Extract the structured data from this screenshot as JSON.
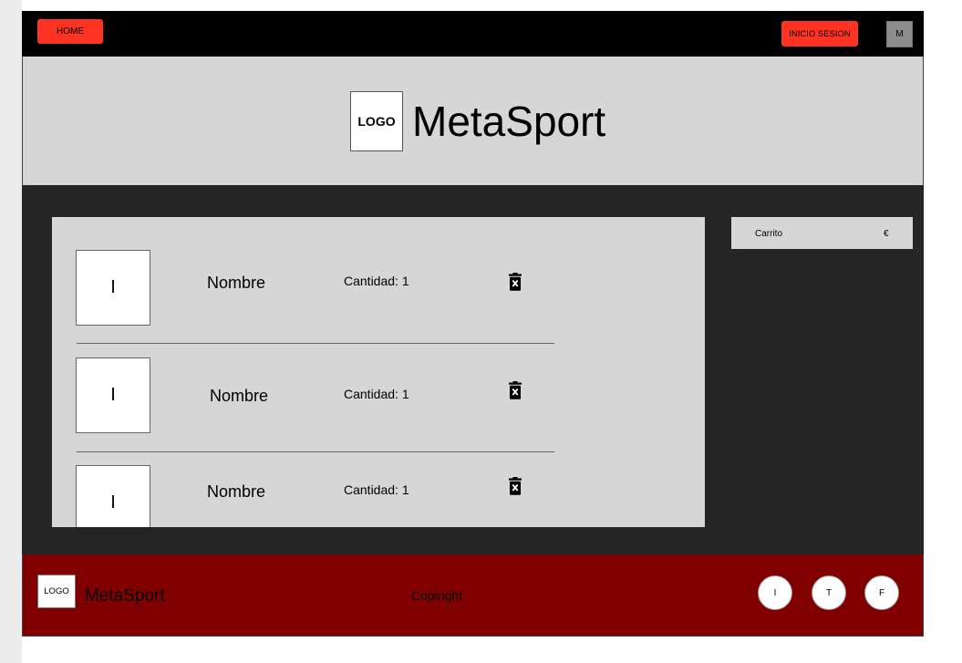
{
  "topbar": {
    "home_label": "HOME",
    "login_label": "INICIO SESION",
    "menu_label": "M"
  },
  "header": {
    "logo_text": "LOGO",
    "brand": "MetaSport"
  },
  "cart_items": [
    {
      "image_label": "I",
      "name": "Nombre",
      "quantity": "Cantidad: 1"
    },
    {
      "image_label": "I",
      "name": "Nombre",
      "quantity": "Cantidad: 1"
    },
    {
      "image_label": "I",
      "name": "Nombre",
      "quantity": "Cantidad: 1"
    }
  ],
  "cart_summary": {
    "label": "Carrito",
    "currency": "€"
  },
  "footer": {
    "logo_text": "LOGO",
    "brand": "MetaSport",
    "copyright": "Copiright",
    "social": [
      "I",
      "T",
      "F"
    ]
  },
  "colors": {
    "accent_red": "#ff3322",
    "footer_bg": "#800000",
    "main_bg": "#252525",
    "panel_bg": "#d6d6d6"
  }
}
